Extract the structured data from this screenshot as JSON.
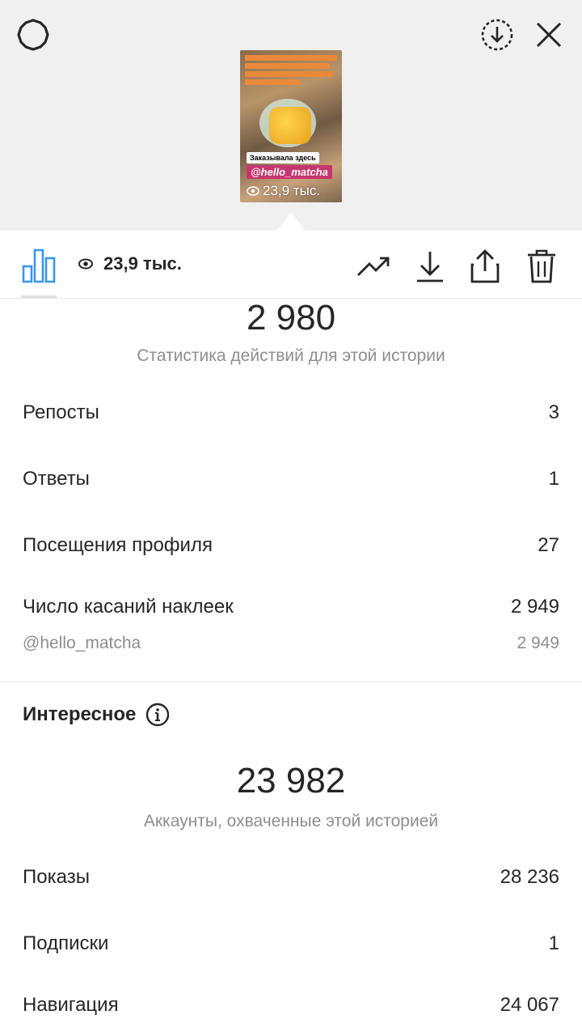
{
  "story_preview": {
    "sticker_label": "Заказывала здесь",
    "mention": "@hello_matcha",
    "views": "23,9 тыс."
  },
  "toolbar": {
    "views": "23,9 тыс."
  },
  "interactions": {
    "total": "2 980",
    "caption": "Статистика действий для этой истории",
    "rows": [
      {
        "label": "Репосты",
        "value": "3"
      },
      {
        "label": "Ответы",
        "value": "1"
      },
      {
        "label": "Посещения профиля",
        "value": "27"
      },
      {
        "label": "Число касаний наклеек",
        "value": "2 949"
      }
    ],
    "sub_row": {
      "label": "@hello_matcha",
      "value": "2 949"
    }
  },
  "discovery": {
    "title": "Интересное",
    "total": "23 982",
    "caption": "Аккаунты, охваченные этой историей",
    "rows": [
      {
        "label": "Показы",
        "value": "28 236"
      },
      {
        "label": "Подписки",
        "value": "1"
      },
      {
        "label": "Навигация",
        "value": "24 067"
      }
    ]
  },
  "colors": {
    "accent": "#3897f0",
    "mention_bg": "#c7356f",
    "caption_bar": "#e98a3a"
  },
  "icons": [
    "settings-icon",
    "save-download-icon",
    "close-icon",
    "insights-icon",
    "eye-icon",
    "trend-icon",
    "download-icon",
    "share-icon",
    "trash-icon",
    "info-icon"
  ]
}
